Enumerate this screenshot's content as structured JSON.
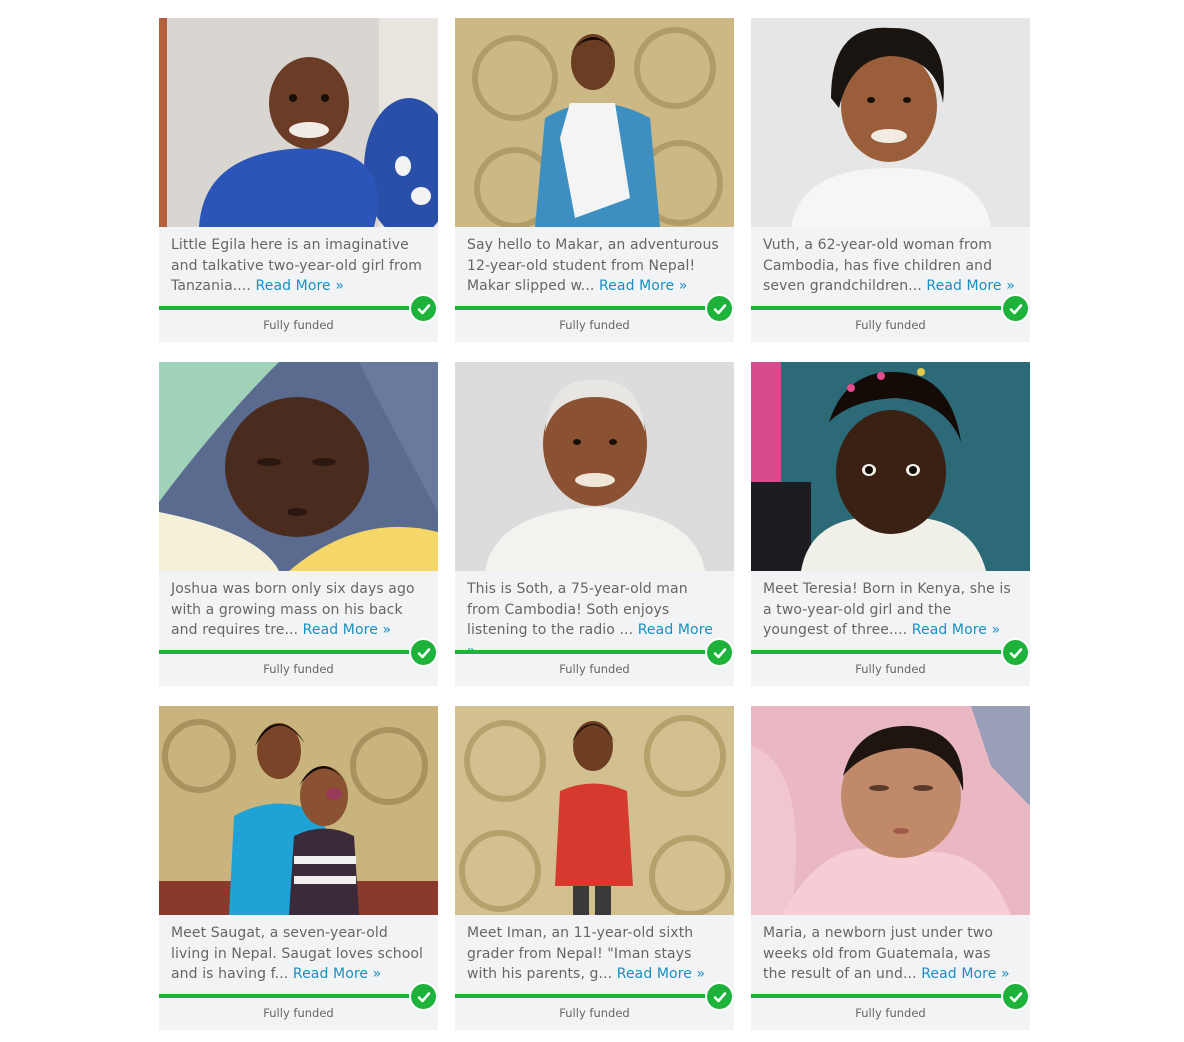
{
  "colors": {
    "accent": "#1db33a",
    "link": "#1a8fc1"
  },
  "cards": [
    {
      "text": "Little Egila here is an imaginative and talkative two-year-old girl from Tanzania....",
      "read_more": "Read More »",
      "status": "Fully funded",
      "funded": 1.0
    },
    {
      "text": "Say hello to Makar, an adventurous 12-year-old student from Nepal! Makar slipped w...",
      "read_more": "Read More »",
      "status": "Fully funded",
      "funded": 1.0
    },
    {
      "text": "Vuth, a 62-year-old woman from Cambodia, has five children and seven grandchildren...",
      "read_more": "Read More »",
      "status": "Fully funded",
      "funded": 1.0
    },
    {
      "text": "Joshua was born only six days ago with a growing mass on his back and requires tre...",
      "read_more": "Read More »",
      "status": "Fully funded",
      "funded": 1.0
    },
    {
      "text": "This is Soth, a 75-year-old man from Cambodia! Soth enjoys listening to the radio ...",
      "read_more": "Read More »",
      "status": "Fully funded",
      "funded": 1.0
    },
    {
      "text": "Meet Teresia! Born in Kenya, she is a two-year-old girl and the youngest of three....",
      "read_more": "Read More »",
      "status": "Fully funded",
      "funded": 1.0
    },
    {
      "text": "Meet Saugat, a seven-year-old living in Nepal. Saugat loves school and is having f...",
      "read_more": "Read More »",
      "status": "Fully funded",
      "funded": 1.0
    },
    {
      "text": "Meet Iman, an 11-year-old sixth grader from Nepal! \"Iman stays with his parents, g...",
      "read_more": "Read More »",
      "status": "Fully funded",
      "funded": 1.0
    },
    {
      "text": "Maria, a newborn just under two weeks old from Guatemala, was the result of an und...",
      "read_more": "Read More »",
      "status": "Fully funded",
      "funded": 1.0
    }
  ]
}
